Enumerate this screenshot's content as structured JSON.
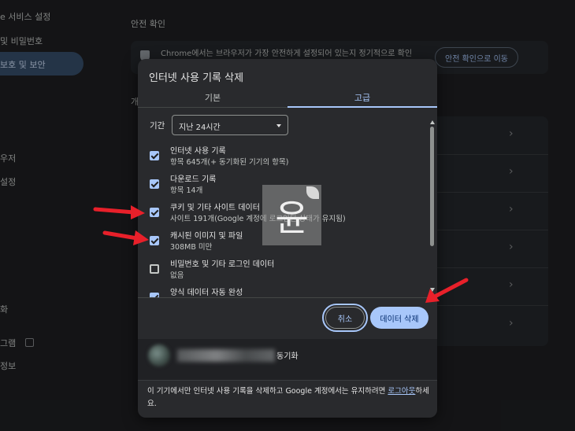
{
  "sidebar": {
    "items": [
      {
        "label": "e 서비스 설정"
      },
      {
        "label": "및 비밀번호"
      },
      {
        "label": "보호 및 보안"
      },
      {
        "label": "우저"
      },
      {
        "label": "설정"
      },
      {
        "label": "화"
      },
      {
        "label": "그램"
      },
      {
        "label": "정보"
      }
    ]
  },
  "main": {
    "safety_title": "안전 확인",
    "safety_text": "Chrome에서는 브라우저가 가장 안전하게 설정되어 있는지 정기적으로 확인",
    "safety_button": "안전 확인으로 이동",
    "section_label": "개"
  },
  "dialog": {
    "title": "인터넷 사용 기록 삭제",
    "tabs": [
      {
        "label": "기본"
      },
      {
        "label": "고급"
      }
    ],
    "active_tab": "고급",
    "period_label": "기간",
    "period_value": "지난 24시간",
    "options": [
      {
        "title": "인터넷 사용 기록",
        "desc": "항목 645개(+ 동기화된 기기의 항목)",
        "checked": true
      },
      {
        "title": "다운로드 기록",
        "desc": "항목 14개",
        "checked": true
      },
      {
        "title": "쿠키 및 기타 사이트 데이터",
        "desc": "사이트 191개(Google 계정에 로그인된 상태가 유지됨)",
        "checked": true
      },
      {
        "title": "캐시된 이미지 및 파일",
        "desc": "308MB 미만",
        "checked": true
      },
      {
        "title": "비밀번호 및 기타 로그인 데이터",
        "desc": "없음",
        "checked": false
      },
      {
        "title": "양식 데이터 자동 완성",
        "desc": "",
        "checked": true
      }
    ],
    "cancel_label": "취소",
    "delete_label": "데이터 삭제",
    "sync_label": "동기화",
    "footer_text": "이 기기에서만 인터넷 사용 기록을 삭제하고 Google 계정에서는 유지하려면 ",
    "footer_link": "로그아웃",
    "footer_suffix": "하세요."
  },
  "watermark": {
    "glyph": "윤"
  },
  "colors": {
    "accent": "#a8c7fa",
    "arrow": "#e8202a",
    "dialog_bg": "#292a2d",
    "page_bg": "#1f2023"
  }
}
